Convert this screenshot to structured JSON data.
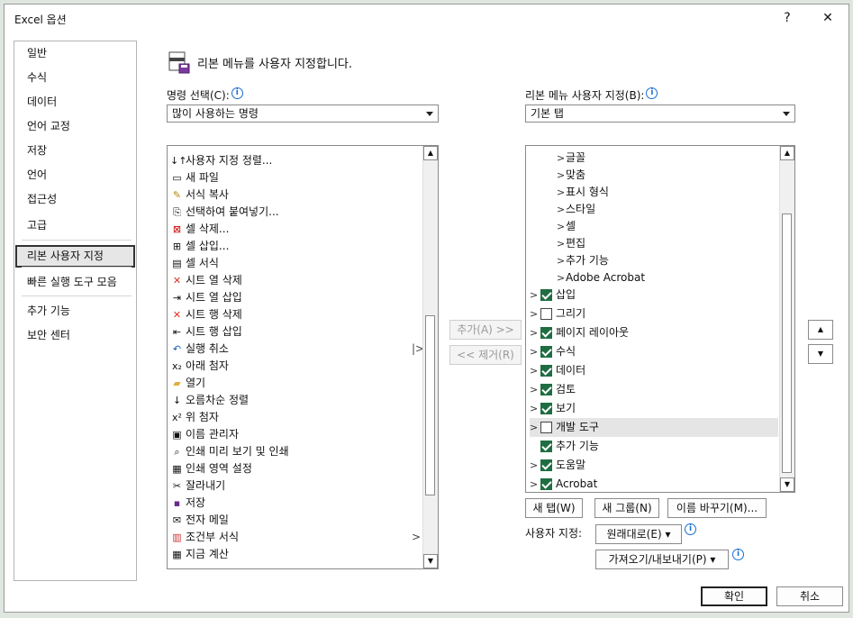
{
  "window": {
    "title": "Excel 옵션",
    "help": "?",
    "close": "✕"
  },
  "nav": {
    "items": [
      {
        "label": "일반"
      },
      {
        "label": "수식"
      },
      {
        "label": "데이터"
      },
      {
        "label": "언어 교정"
      },
      {
        "label": "저장"
      },
      {
        "label": "언어"
      },
      {
        "label": "접근성"
      },
      {
        "label": "고급"
      },
      {
        "label": "리본 사용자 지정"
      },
      {
        "label": "빠른 실행 도구 모음"
      },
      {
        "label": "추가 기능"
      },
      {
        "label": "보안 센터"
      }
    ],
    "selected": "리본 사용자 지정"
  },
  "header": {
    "text": "리본 메뉴를 사용자 지정합니다."
  },
  "left": {
    "label": "명령 선택(C):",
    "combo_value": "많이 사용하는 명령",
    "commands": [
      {
        "label": "사용자 지정 정렬...",
        "icon": "sort-icon"
      },
      {
        "label": "새 파일",
        "icon": "new-file-icon"
      },
      {
        "label": "서식 복사",
        "icon": "format-painter-icon"
      },
      {
        "label": "선택하여 붙여넣기...",
        "icon": "paste-special-icon"
      },
      {
        "label": "셀 삭제...",
        "icon": "delete-cells-icon"
      },
      {
        "label": "셀 삽입...",
        "icon": "insert-cells-icon"
      },
      {
        "label": "셀 서식",
        "icon": "format-cells-icon"
      },
      {
        "label": "시트 열 삭제",
        "icon": "delete-columns-icon"
      },
      {
        "label": "시트 열 삽입",
        "icon": "insert-columns-icon"
      },
      {
        "label": "시트 행 삭제",
        "icon": "delete-rows-icon"
      },
      {
        "label": "시트 행 삽입",
        "icon": "insert-rows-icon"
      },
      {
        "label": "실행 취소",
        "icon": "undo-icon",
        "sub": "|>"
      },
      {
        "label": "아래 첨자",
        "icon": "subscript-icon"
      },
      {
        "label": "열기",
        "icon": "open-folder-icon"
      },
      {
        "label": "오름차순 정렬",
        "icon": "sort-ascending-icon"
      },
      {
        "label": "위 첨자",
        "icon": "superscript-icon"
      },
      {
        "label": "이름 관리자",
        "icon": "name-manager-icon"
      },
      {
        "label": "인쇄 미리 보기 및 인쇄",
        "icon": "print-preview-icon"
      },
      {
        "label": "인쇄 영역 설정",
        "icon": "print-area-icon"
      },
      {
        "label": "잘라내기",
        "icon": "cut-icon"
      },
      {
        "label": "저장",
        "icon": "save-icon"
      },
      {
        "label": "전자 메일",
        "icon": "email-icon"
      },
      {
        "label": "조건부 서식",
        "icon": "conditional-format-icon",
        "sub": ">"
      },
      {
        "label": "지금 계산",
        "icon": "calculator-icon"
      }
    ]
  },
  "middle": {
    "add": "추가(A) >>",
    "remove": "<< 제거(R)"
  },
  "right": {
    "label": "리본 메뉴 사용자 지정(B):",
    "combo_value": "기본 탭",
    "groups": [
      {
        "label": "글꼴"
      },
      {
        "label": "맞춤"
      },
      {
        "label": "표시 형식"
      },
      {
        "label": "스타일"
      },
      {
        "label": "셀"
      },
      {
        "label": "편집"
      },
      {
        "label": "추가 기능"
      },
      {
        "label": "Adobe Acrobat"
      }
    ],
    "tabs": [
      {
        "label": "삽입",
        "checked": true,
        "expandable": true
      },
      {
        "label": "그리기",
        "checked": false,
        "expandable": true
      },
      {
        "label": "페이지 레이아웃",
        "checked": true,
        "expandable": true
      },
      {
        "label": "수식",
        "checked": true,
        "expandable": true
      },
      {
        "label": "데이터",
        "checked": true,
        "expandable": true
      },
      {
        "label": "검토",
        "checked": true,
        "expandable": true
      },
      {
        "label": "보기",
        "checked": true,
        "expandable": true
      },
      {
        "label": "개발 도구",
        "checked": false,
        "expandable": true,
        "highlighted": true
      },
      {
        "label": "추가 기능",
        "checked": true,
        "expandable": false
      },
      {
        "label": "도움말",
        "checked": true,
        "expandable": true
      },
      {
        "label": "Acrobat",
        "checked": true,
        "expandable": true
      }
    ],
    "new_tab": "새 탭(W)",
    "new_group": "새 그룹(N)",
    "rename": "이름 바꾸기(M)...",
    "customize_label": "사용자 지정:",
    "reset": "원래대로(E)",
    "import_export": "가져오기/내보내기(P)"
  },
  "footer": {
    "ok": "확인",
    "cancel": "취소"
  }
}
